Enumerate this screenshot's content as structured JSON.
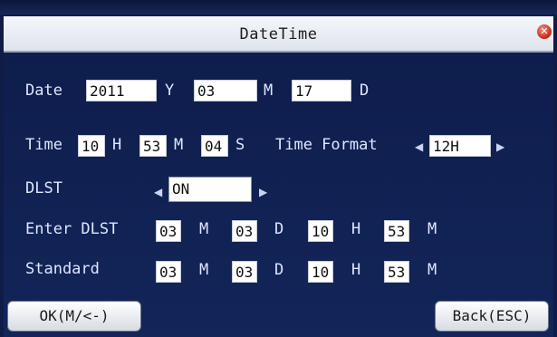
{
  "window": {
    "title": "DateTime"
  },
  "date": {
    "label": "Date",
    "year": "2011",
    "year_unit": "Y",
    "month": "03",
    "month_unit": "M",
    "day": "17",
    "day_unit": "D"
  },
  "time": {
    "label": "Time",
    "hour": "10",
    "hour_unit": "H",
    "minute": "53",
    "minute_unit": "M",
    "second": "04",
    "second_unit": "S",
    "format_label": "Time Format",
    "format_value": "12H"
  },
  "dlst": {
    "label": "DLST",
    "value": "ON"
  },
  "enter_dlst": {
    "label": "Enter DLST",
    "month": "03",
    "month_unit": "M",
    "day": "03",
    "day_unit": "D",
    "hour": "10",
    "hour_unit": "H",
    "minute": "53",
    "minute_unit": "M"
  },
  "standard": {
    "label": "Standard",
    "month": "03",
    "month_unit": "M",
    "day": "03",
    "day_unit": "D",
    "hour": "10",
    "hour_unit": "H",
    "minute": "53",
    "minute_unit": "M"
  },
  "buttons": {
    "ok": "OK(M/<-)",
    "back": "Back(ESC)"
  },
  "icons": {
    "close": "close-icon",
    "left": "left-arrow-icon",
    "right": "right-arrow-icon"
  }
}
